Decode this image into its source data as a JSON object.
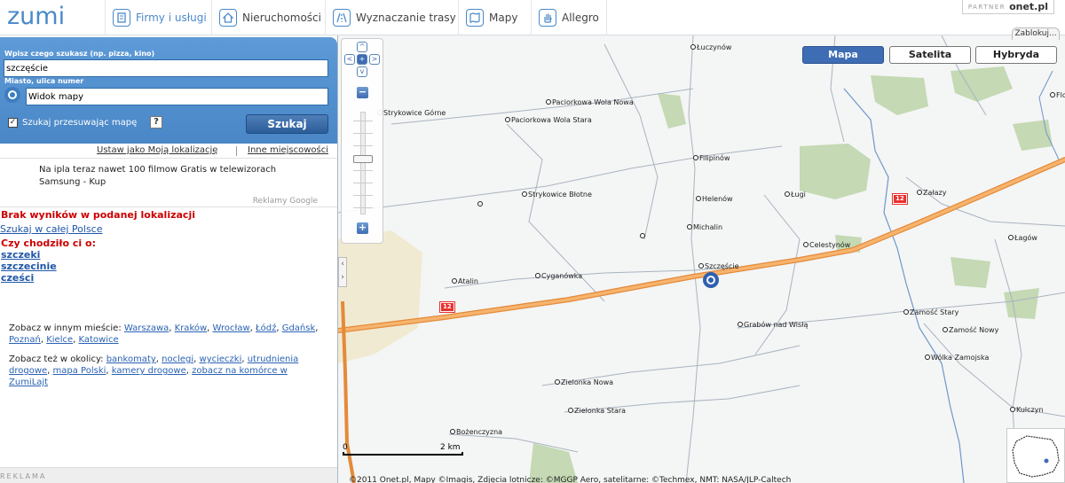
{
  "brand": {
    "logo_text": "zumi",
    "accent": "#4a89c9"
  },
  "nav": {
    "tabs": [
      {
        "label": "Firmy i usługi",
        "icon": "phonebook-icon",
        "active": true
      },
      {
        "label": "Nieruchomości",
        "icon": "house-icon",
        "active": false
      },
      {
        "label": "Wyznaczanie trasy",
        "icon": "road-icon",
        "active": false
      },
      {
        "label": "Mapy",
        "icon": "map-icon",
        "active": false
      },
      {
        "label": "Allegro",
        "icon": "hand-icon",
        "active": false
      }
    ],
    "partner_label": "PARTNER",
    "partner_name": "onet.pl",
    "lock_tab": "Zablokuj..."
  },
  "search": {
    "what_label": "Wpisz czego szukasz (np. pizza, kino)",
    "what_value": "szczęście",
    "where_label": "Miasto, ulica numer",
    "where_value": "Widok mapy",
    "checkbox_label": "Szukaj przesuwając mapę",
    "checkbox_checked": true,
    "help": "?",
    "button": "Szukaj"
  },
  "location_links": {
    "set_location": "Ustaw jako Moją lokalizację",
    "other_places": "Inne miejscowości"
  },
  "ad": {
    "text": "Na ipla teraz nawet 100 filmow Gratis w telewizorach Samsung - Kup",
    "provider": "Reklamy Google"
  },
  "results": {
    "no_results": "Brak wyników w podanej lokalizacji",
    "search_all": "Szukaj w całej Polsce",
    "did_you_mean": "Czy chodziło ci o:",
    "suggestions": [
      "szczeki",
      "szczecinie",
      "cześci"
    ]
  },
  "see_other_city": {
    "prefix": "Zobacz w innym mieście:",
    "cities": [
      "Warszawa",
      "Kraków",
      "Wrocław",
      "Łódź",
      "Gdańsk",
      "Poznań",
      "Kielce",
      "Katowice"
    ]
  },
  "see_nearby": {
    "prefix": "Zobacz też w okolicy:",
    "links": [
      "bankomaty",
      "noclegi",
      "wycieczki",
      "utrudnienia drogowe",
      "mapa Polski",
      "kamery drogowe",
      "zobacz na komórce w ZumiLajt"
    ]
  },
  "reklama_bar": "REKLAMA",
  "map": {
    "types": [
      {
        "label": "Mapa",
        "active": true
      },
      {
        "label": "Satelita",
        "active": false
      },
      {
        "label": "Hybryda",
        "active": false
      }
    ],
    "towns": [
      "Łuczynów",
      "Strykowice Górne",
      "Paciorkowa Wola Nowa",
      "Paciorkowa Wola Stara",
      "Filipinów",
      "Strykowice Błotne",
      "Helenów",
      "Ługi",
      "Załazy",
      "Michalin",
      "Celestynów",
      "Łagów",
      "Szczęście",
      "Atalin",
      "Cyganówka",
      "Grabów nad Wisłą",
      "Zamość Stary",
      "Zamość Nowy",
      "Wólka Zamojska",
      "Zielonka Nowa",
      "Zielonka Stara",
      "Kulczyn",
      "Bożenczyzna",
      "Floria"
    ],
    "road_number": "12",
    "scale_zero": "0",
    "scale_label": "2 km",
    "copyright": "©2011 Onet.pl, Mapy ©Imagis, Zdjęcia lotnicze: ©MGGP Aero, satelitarne: ©Techmex, NMT: NASA/JLP-Caltech",
    "zoom_in": "+",
    "zoom_out": "−",
    "pan_up": "^",
    "pan_down": "v",
    "pan_left": "<",
    "pan_right": ">",
    "pan_center": "+"
  }
}
